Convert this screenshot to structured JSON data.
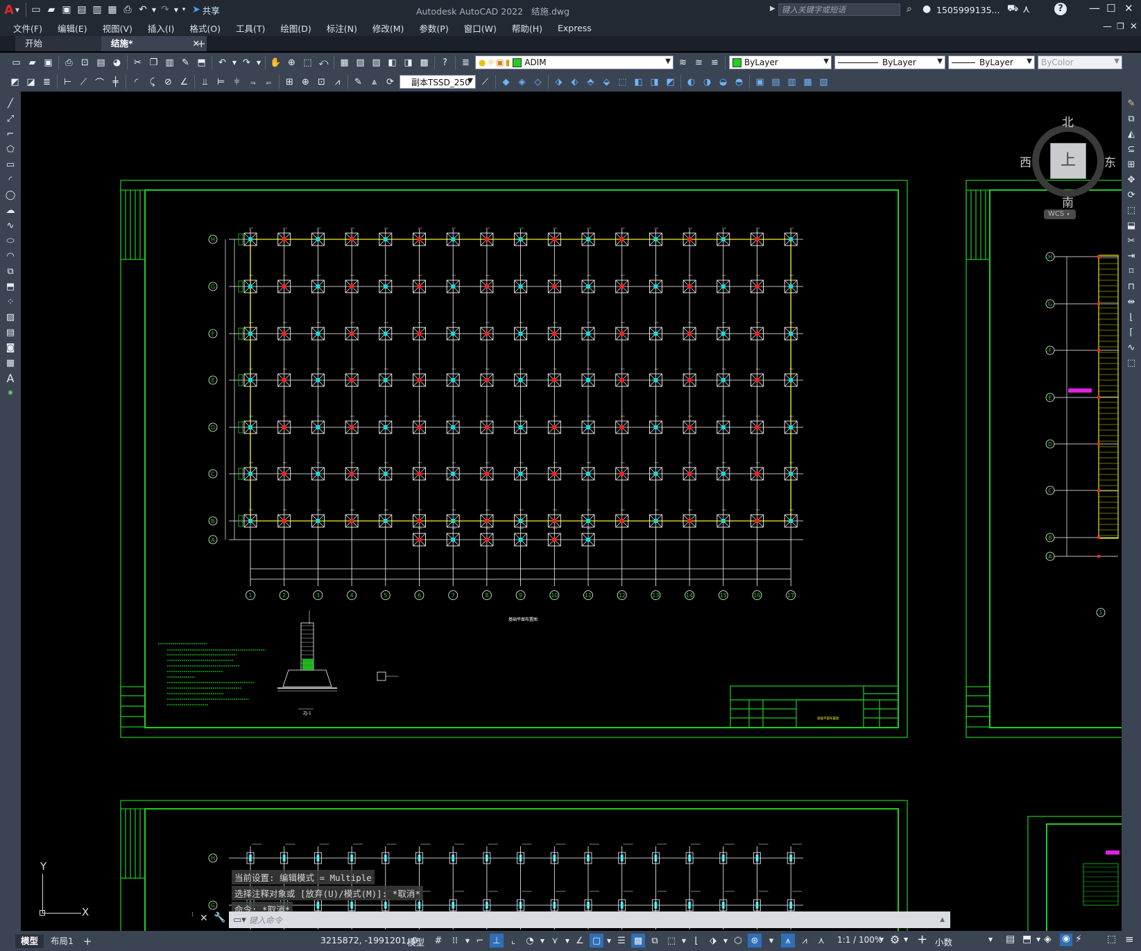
{
  "app": {
    "title": "Autodesk AutoCAD 2022",
    "filename": "结施.dwg",
    "share_label": "共享",
    "search_placeholder": "键入关键字或短语",
    "user": "1505999135...",
    "logo": "A"
  },
  "menu": [
    "文件(F)",
    "编辑(E)",
    "视图(V)",
    "插入(I)",
    "格式(O)",
    "工具(T)",
    "绘图(D)",
    "标注(N)",
    "修改(M)",
    "参数(P)",
    "窗口(W)",
    "帮助(H)",
    "Express"
  ],
  "tabs": {
    "start": "开始",
    "active": "结施*",
    "close": "✕",
    "add": "+"
  },
  "layer_dropdown": "ADIM",
  "color_dropdown": "ByLayer",
  "linetype_dropdown": "ByLayer",
  "lineweight_dropdown": "ByLayer",
  "plotstyle_dropdown": "ByColor",
  "dimstyle_dropdown": "副本TSSD_250",
  "viewcube": {
    "north": "北",
    "south": "南",
    "east": "东",
    "west": "西",
    "face": "上",
    "wcs": "WCS"
  },
  "ucs": {
    "x": "X",
    "y": "Y"
  },
  "command_history": [
    "当前设置: 编辑模式 = Multiple",
    "选择注释对象或 [放弃(U)/模式(M)]: *取消*",
    "命令: *取消*"
  ],
  "command_placeholder": "键入命令",
  "status": {
    "coords": "3215872, -1991201, 0",
    "model_label": "模型",
    "scale": "1:1 / 100%",
    "units": "小数"
  },
  "layout_tabs": [
    "模型",
    "布局1"
  ],
  "drawing": {
    "rows": [
      "H",
      "G",
      "F",
      "E",
      "D",
      "C",
      "B",
      "A"
    ],
    "columns": [
      "1",
      "2",
      "3",
      "4",
      "5",
      "6",
      "7",
      "8",
      "9",
      "10",
      "11",
      "12",
      "13",
      "14",
      "15",
      "16",
      "17"
    ],
    "side_rows": [
      "H",
      "G",
      "F",
      "E",
      "D",
      "C",
      "B",
      "A"
    ],
    "side_col": "1",
    "plan_title": "基础平面布置图",
    "detail_label": "ZJ-1",
    "title_block_name": "基础平面布置图"
  },
  "colors": {
    "green": "#1fd01f",
    "cyan": "#19d9e0",
    "yellow": "#e8e800",
    "white": "#ffffff",
    "magenta": "#e020e0",
    "red": "#ff2020"
  }
}
